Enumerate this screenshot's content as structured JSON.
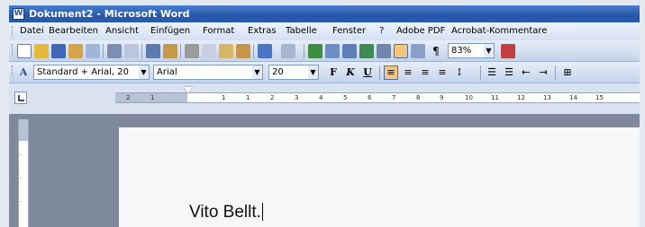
{
  "window": {
    "title": "Dokument2 - Microsoft Word",
    "icon": "word-doc-icon"
  },
  "menu": [
    {
      "name": "menu-datei",
      "label": "Datei"
    },
    {
      "name": "menu-bearbeiten",
      "label": "Bearbeiten"
    },
    {
      "name": "menu-ansicht",
      "label": "Ansicht"
    },
    {
      "name": "menu-einfuegen",
      "label": "Einfügen"
    },
    {
      "name": "menu-format",
      "label": "Format"
    },
    {
      "name": "menu-extras",
      "label": "Extras"
    },
    {
      "name": "menu-tabelle",
      "label": "Tabelle"
    },
    {
      "name": "menu-fenster",
      "label": "Fenster"
    },
    {
      "name": "menu-help",
      "label": "?"
    },
    {
      "name": "menu-adobe-pdf",
      "label": "Adobe PDF"
    },
    {
      "name": "menu-acrobat-kommentare",
      "label": "Acrobat-Kommentare"
    }
  ],
  "standard_toolbar": {
    "icons": [
      "new-document-icon",
      "open-icon",
      "save-icon",
      "permission-icon",
      "email-icon",
      "print-icon",
      "print-preview-icon",
      "spelling-icon",
      "research-icon",
      "cut-icon",
      "copy-icon",
      "paste-icon",
      "format-painter-icon",
      "undo-icon",
      "redo-icon",
      "hyperlink-icon",
      "tables-borders-icon",
      "insert-table-icon",
      "insert-excel-icon",
      "columns-icon",
      "drawing-icon",
      "document-map-icon",
      "show-formatting-icon"
    ],
    "zoom": "83%"
  },
  "formatting_toolbar": {
    "style": "Standard + Arial, 20",
    "font": "Arial",
    "size": "20",
    "bold": "F",
    "italic": "K",
    "underline": "U"
  },
  "ruler": {
    "labels": [
      "2",
      "1",
      "1",
      "1",
      "2",
      "3",
      "4",
      "5",
      "6",
      "7",
      "8",
      "9",
      "10",
      "11",
      "12",
      "13",
      "14",
      "15"
    ]
  },
  "document": {
    "text": "Vito Bellt."
  },
  "colors": {
    "title_bar": "#2757a8",
    "toolbar": "#d4e0f2",
    "active_button": "#f5c77e",
    "doc_background": "#7e8a9c"
  }
}
